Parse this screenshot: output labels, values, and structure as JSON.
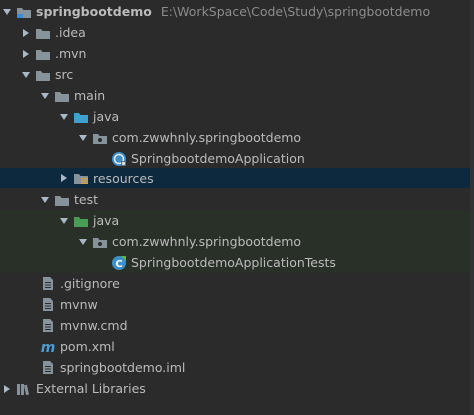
{
  "project": {
    "name": "springbootdemo",
    "path": "E:\\WorkSpace\\Code\\Study\\springbootdemo"
  },
  "tree": {
    "idea": ".idea",
    "mvn": ".mvn",
    "src": "src",
    "main": "main",
    "main_java": "java",
    "main_package": "com.zwwhnly.springbootdemo",
    "main_class": "SpringbootdemoApplication",
    "resources": "resources",
    "test": "test",
    "test_java": "java",
    "test_package": "com.zwwhnly.springbootdemo",
    "test_class": "SpringbootdemoApplicationTests",
    "gitignore": ".gitignore",
    "mvnw": "mvnw",
    "mvnw_cmd": "mvnw.cmd",
    "pom": "pom.xml",
    "iml": "springbootdemo.iml",
    "external_libraries": "External Libraries"
  },
  "colors": {
    "background": "#2b2b2b",
    "selection": "#0d293e",
    "test_root_tint": "#293028",
    "folder": "#87939a",
    "source_folder": "#40a0d0",
    "test_folder": "#499c54",
    "maven_m": "#4a9cd6"
  }
}
